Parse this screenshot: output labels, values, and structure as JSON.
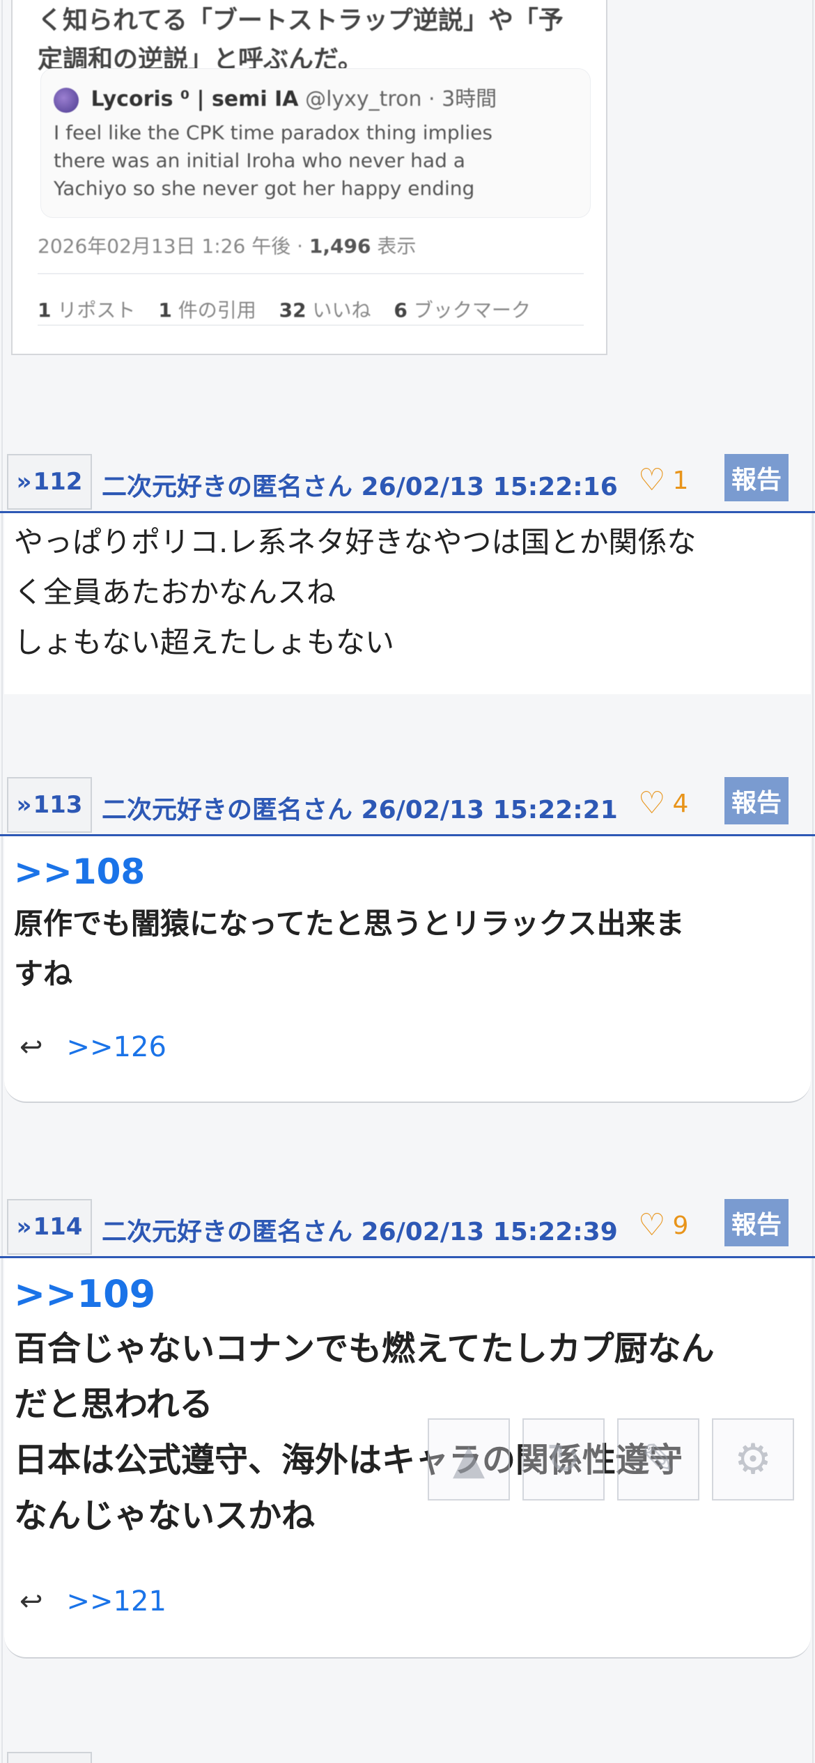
{
  "tweet": {
    "text_lines": [
      "く知られてる「ブートストラップ逆説」や「予",
      "定調和の逆説」と呼ぶんだ。"
    ],
    "quote": {
      "author": "Lycoris ⁰ | semi IA",
      "handle": "@lyxy_tron · 3時間",
      "body_lines": [
        "I feel like the CPK time paradox thing implies",
        "there was an initial Iroha who never had a",
        "Yachiyo so she never got her happy ending"
      ]
    },
    "meta_date": "2026年02月13日 1:26 午後 · ",
    "meta_views": "1,496",
    "meta_views_label": " 表示",
    "stats": {
      "reposts": "1",
      "reposts_label": "リポスト",
      "quotes": "1",
      "quotes_label": "件の引用",
      "likes": "32",
      "likes_label": "いいね",
      "bookmarks": "6",
      "bookmarks_label": "ブックマーク"
    }
  },
  "posts": [
    {
      "number": "112",
      "name_date": "二次元好きの匿名さん 26/02/13 15:22:16",
      "likes": "1",
      "report": "報告",
      "lines": [
        "やっぱりポリコ.レ系ネタ好きなやつは国とか関係な",
        "く全員あたおかなんスね",
        "しょもない超えたしょもない"
      ]
    },
    {
      "number": "113",
      "name_date": "二次元好きの匿名さん 26/02/13 15:22:21",
      "likes": "4",
      "report": "報告",
      "anchor": ">>108",
      "lines": [
        "原作でも闇猿になってたと思うとリラックス出来ま",
        "すね"
      ],
      "reply": ">>126"
    },
    {
      "number": "114",
      "name_date": "二次元好きの匿名さん 26/02/13 15:22:39",
      "likes": "9",
      "report": "報告",
      "anchor": ">>109",
      "lines": [
        "百合じゃないコナンでも燃えてたしカプ厨なん",
        "だと思われる",
        "日本は公式遵守、海外はキャラの関係性遵守",
        "なんじゃないスかね"
      ],
      "reply": ">>121"
    }
  ],
  "icons": {
    "like": "heart-outline-icon",
    "reply": "reply-arrow-icon",
    "post_number": "double-chevron-icon",
    "toolbar": [
      "arrow-up-icon",
      "refresh-icon",
      "edit-icon",
      "gear-icon"
    ]
  },
  "colors": {
    "link": "#2d58b5",
    "anchor": "#1a73e8",
    "like": "#e8941a",
    "report_bg": "#7a9bd0"
  }
}
